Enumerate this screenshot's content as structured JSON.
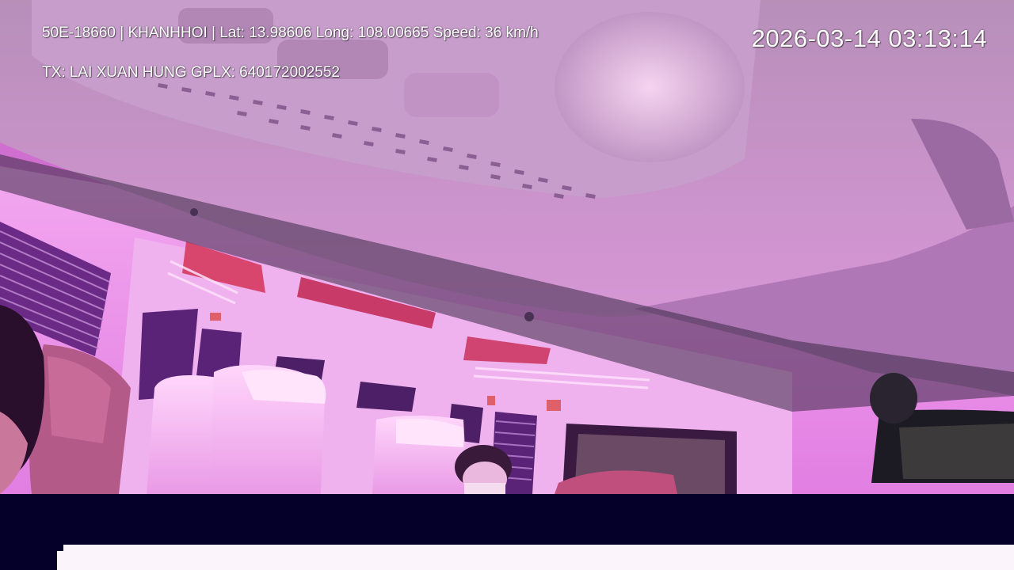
{
  "overlay": {
    "vehicle_info": "50E-18660 | KHANHHOI | Lat: 13.98606 Long: 108.00665 Speed: 36 km/h",
    "driver_info": "TX: LAI XUAN HUNG GPLX: 640172002552",
    "timestamp": "2026-03-14 03:13:14"
  },
  "scene": {
    "tint_color": "#e07ae0",
    "band_color": "#05002a",
    "strip_color": "#fbf4fb"
  }
}
